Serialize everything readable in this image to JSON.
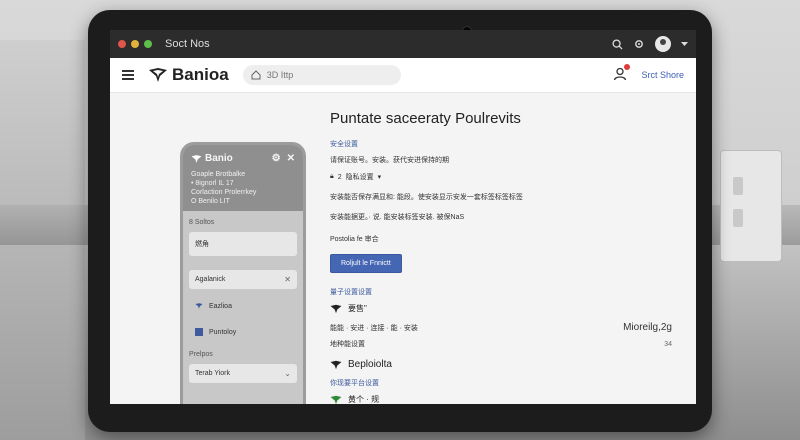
{
  "titlebar": {
    "title": "Soct Nos"
  },
  "appbar": {
    "brand": "Banioa",
    "search_placeholder": "3D Ittp",
    "right_link": "Srct Shore"
  },
  "phone": {
    "header_title": "Banio",
    "header_lines": [
      "Goaple Brotbalke",
      "• 8ignorl IL 17",
      "Corlaction Prolerrkey",
      "O Benilo LIT"
    ],
    "items": [
      "8 Soltos",
      "燃角",
      "Agalanick",
      "Eazlioa",
      "Puntoloy",
      "Prelpos",
      "Terab Yiork"
    ]
  },
  "main": {
    "title": "Puntate saceeraty Poulrevits",
    "section1_head": "安全设置",
    "section1_line": "请保证账号。安装。获代安进保持的期",
    "section1_small_1": "2",
    "section1_small_2": "隐私设置",
    "row_a": "安装能否保存满显和: 能段。使安装显示安发一套标签标签标签",
    "row_b": "安装能据更。· 说. 能安装标签安装. 被保NaS",
    "btn_label_caption": "Postolia fe 审合",
    "button_label": "Roljult le Fnnictt",
    "section2_head": "量子设置设置",
    "item1": "要售\"",
    "item1_desc": "能能 · 安进 · 连接 · 能 · 安装",
    "item1_value": "Mioreilg,2g",
    "item1_desc2": "地种能设置",
    "item1_value2": "34",
    "item2": "Beploiolta",
    "section3_head": "你现要平台设置",
    "item3": "黄个 · 规"
  }
}
